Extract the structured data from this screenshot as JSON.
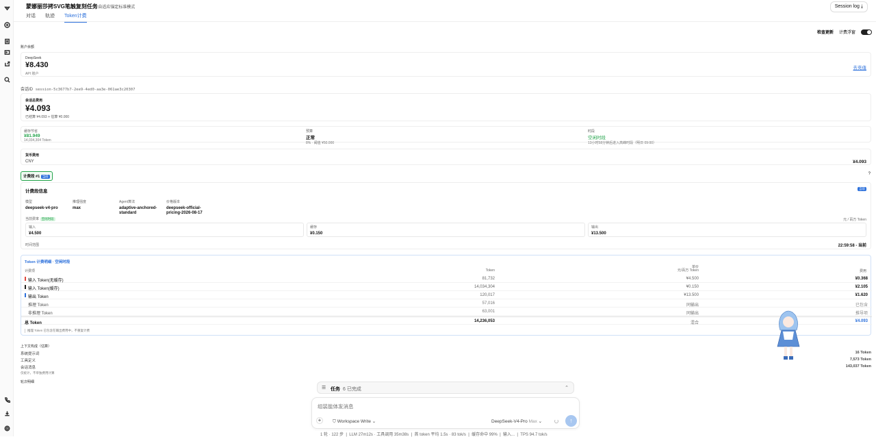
{
  "app": {
    "title": "蒙娜丽莎拷SVG笔触复刻任务",
    "mode": "自适应锚定标准模式",
    "session_log": "Session log"
  },
  "tabs": [
    "对话",
    "轨迹",
    "Token计费"
  ],
  "tools": {
    "check_update": "检查更新",
    "float_label": "计费浮窗"
  },
  "balance": {
    "section": "账户余额",
    "provider": "DeepSeek",
    "amount": "¥8.430",
    "account": "API 账户",
    "recharge": "去充值"
  },
  "session": {
    "label": "会话ID",
    "id": "session-5c3677b7-2ee9-4ed0-aa3e-061ae3c20307"
  },
  "total": {
    "label": "会话总费用",
    "amount": "¥4.093",
    "detail": "已结算 ¥4.093 + 估算 ¥0.000"
  },
  "stats": [
    {
      "label": "缓存节省",
      "value": "¥81.949",
      "sub": "14,034,304 Token"
    },
    {
      "label": "预算",
      "value": "正常",
      "sub": "8% · 阈值 ¥50.000"
    },
    {
      "label": "时段",
      "value": "空闲时段",
      "sub": "13小时58分钟后进入高峰时段（明日 09:00）"
    }
  ],
  "currency": {
    "label": "货币费用",
    "code": "CNY",
    "amount": "¥4.093"
  },
  "segment": {
    "tag": "计费段 #1",
    "badge": "当前",
    "q": "?"
  },
  "info": {
    "title": "计费段信息",
    "badge": "当前",
    "cols": [
      {
        "k": "模型",
        "v": "deepseek-v4-pro"
      },
      {
        "k": "推理强度",
        "v": "max"
      },
      {
        "k": "Agent算法",
        "v": "adaptive-anchored-standard"
      },
      {
        "k": "价格版本",
        "v": "deepseek-official-pricing-2026-08-17"
      }
    ],
    "price_label": "当前费率",
    "price_badge": "空闲时段",
    "unit": "元 / 百万 Token",
    "prices": [
      {
        "k": "输入",
        "v": "¥4.500"
      },
      {
        "k": "缓存",
        "v": "¥0.150"
      },
      {
        "k": "输出",
        "v": "¥13.500"
      }
    ],
    "time_label": "时间范围",
    "time_value": "22:59:58 - 当前"
  },
  "breakdown": {
    "title": "Token 计费明细 · 空闲时段",
    "headers": [
      "计费项",
      "Token",
      "单价",
      "元/百万 Token",
      "费用"
    ],
    "rows": [
      {
        "name": "输入 Token(无缓存)",
        "tokens": "81,732",
        "price": "¥4.500",
        "cost": "¥0.368",
        "color": "#e0483e"
      },
      {
        "name": "输入 Token(缓存)",
        "tokens": "14,034,304",
        "price": "¥0.150",
        "cost": "¥2.105",
        "color": "#222"
      },
      {
        "name": "输出 Token",
        "tokens": "120,017",
        "price": "¥13.500",
        "cost": "¥1.620",
        "color": "#2a6fdb"
      },
      {
        "name": "推理 Token",
        "tokens": "57,016",
        "price": "同输出",
        "cost": "已包含",
        "color": ""
      },
      {
        "name": "非推理 Token",
        "tokens": "63,001",
        "price": "同输出",
        "cost": "推导项",
        "color": ""
      },
      {
        "name": "总 Token",
        "tokens": "14,236,053",
        "price": "混合",
        "cost": "¥4.093",
        "color": ""
      }
    ],
    "note": "推理 Token 已包含在输出费用中，不重复计费"
  },
  "context": {
    "title": "上下文构成（估算）",
    "rows": [
      {
        "k": "系统提示词",
        "v": "16 Token"
      },
      {
        "k": "工具定义",
        "v": "7,573 Token"
      },
      {
        "k": "会话消息",
        "v": "143,037 Token"
      }
    ],
    "note": "仅统计，不单独费用计算",
    "turns": "轮次明细"
  },
  "tasks": {
    "label": "任务",
    "count": "6 已完成"
  },
  "composer": {
    "placeholder": "组装能体发消息",
    "workspace": "Workspace Write",
    "model": "DeepSeek-V4-Pro",
    "effort": "Max"
  },
  "status": [
    "1 轮 · 122 步",
    "LLM 27m12s · 工具调用 35m38s",
    "首 token 平均 1.5s · 83 tok/s",
    "缓存命中 99%",
    "输入...",
    "TPS 94.7 tok/s"
  ]
}
